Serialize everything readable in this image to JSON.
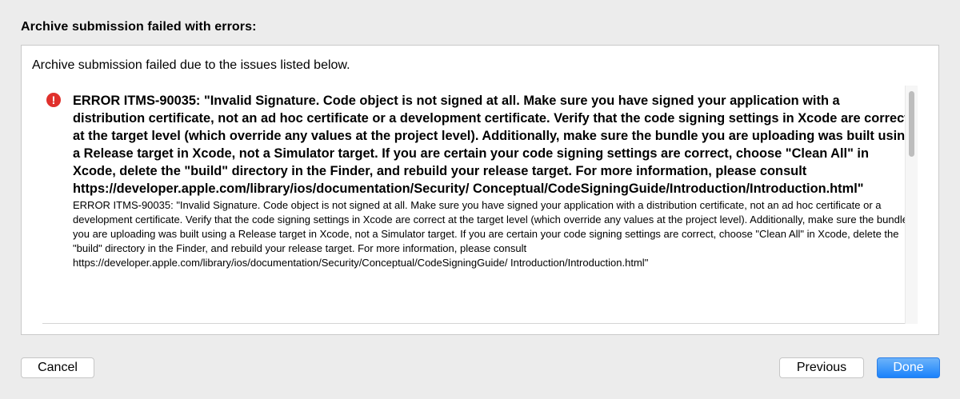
{
  "dialog": {
    "heading": "Archive submission failed with errors:",
    "intro": "Archive submission failed due to the issues listed below.",
    "issues": [
      {
        "icon": "error-icon",
        "icon_glyph": "!",
        "icon_color": "#e0302c",
        "title": "ERROR ITMS-90035: \"Invalid Signature. Code object is not signed at all. Make sure you have signed your application with a distribution certificate, not an ad hoc certificate or a development certificate. Verify that the code signing settings in Xcode are correct at the target level (which override any values at the project level). Additionally, make sure the bundle you are uploading was built using a Release target in Xcode, not a Simulator target. If you are certain your code signing settings are correct, choose \"Clean All\" in Xcode, delete the \"build\" directory in the Finder, and rebuild your release target. For more information, please consult https://developer.apple.com/library/ios/documentation/Security/ Conceptual/CodeSigningGuide/Introduction/Introduction.html\"",
        "detail": "ERROR ITMS-90035: \"Invalid Signature. Code object is not signed at all. Make sure you have signed your application with a distribution certificate, not an ad hoc certificate or a development certificate. Verify that the code signing settings in Xcode are correct at the target level (which override any values at the project level). Additionally, make sure the bundle you are uploading was built using a Release target in Xcode, not a Simulator target. If you are certain your code signing settings are correct, choose \"Clean All\" in Xcode, delete the \"build\" directory in the Finder, and rebuild your release target. For more information, please consult https://developer.apple.com/library/ios/documentation/Security/Conceptual/CodeSigningGuide/ Introduction/Introduction.html\""
      }
    ]
  },
  "buttons": {
    "cancel": "Cancel",
    "previous": "Previous",
    "done": "Done"
  },
  "colors": {
    "accent": "#1a82fb",
    "error": "#e0302c",
    "background": "#ececec"
  }
}
